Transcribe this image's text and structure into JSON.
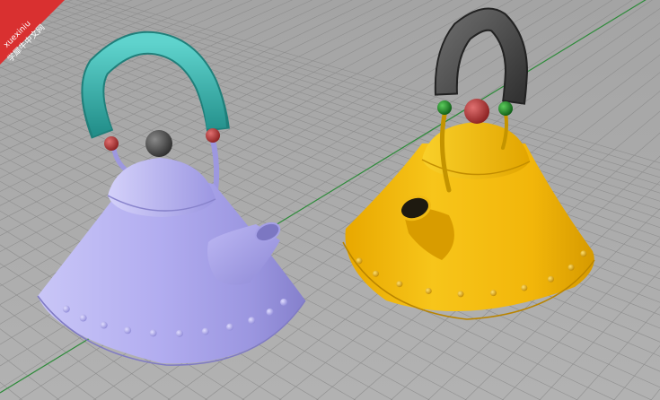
{
  "viewport": {
    "background": "#a9a9a9",
    "grid_color": "#8e8e8e",
    "axis_x_color": "#9a2a2a",
    "axis_y_color": "#2e8b3a"
  },
  "watermark": {
    "line1": "xuexiniu",
    "line2": "学犀牛中文网",
    "color": "#e03030"
  },
  "objects": [
    {
      "name": "lavender-kettle",
      "body_color": "#b7b2f2",
      "handle_color": "#3ab5b0",
      "knob_color": "#4a4a4a",
      "joint_color": "#b83838"
    },
    {
      "name": "yellow-kettle",
      "body_color": "#f2b70a",
      "handle_color": "#4e4e4e",
      "knob_color": "#b83838",
      "joint_color": "#1f8a2a"
    }
  ]
}
